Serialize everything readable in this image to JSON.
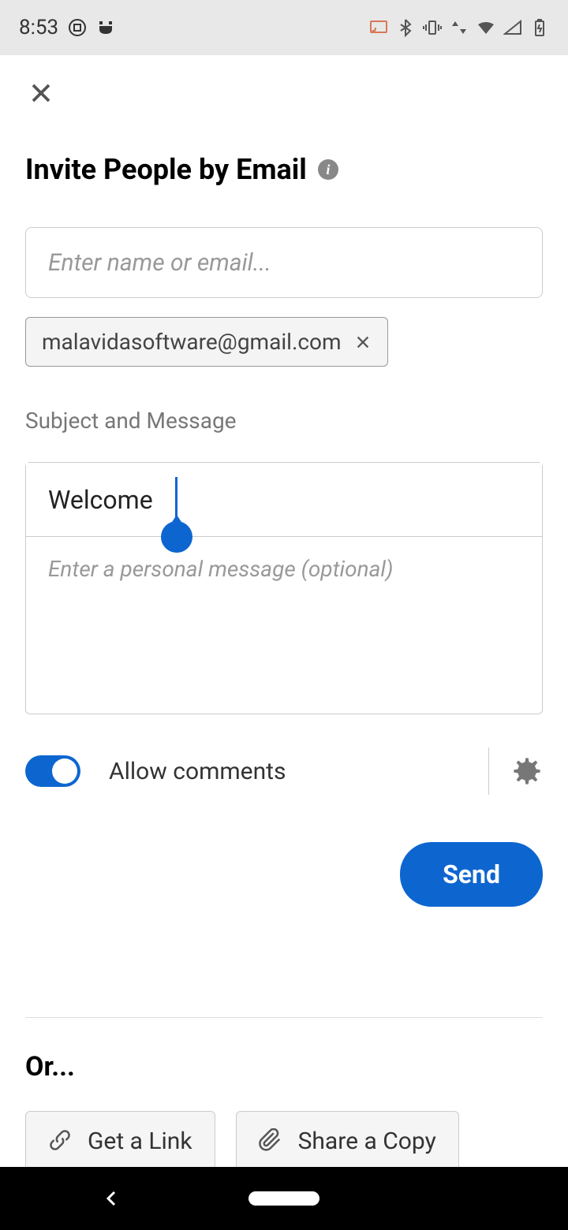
{
  "statusbar": {
    "time": "8:53"
  },
  "header": {
    "title": "Invite People by Email"
  },
  "emailInput": {
    "placeholder": "Enter name or email..."
  },
  "emailChip": {
    "email": "malavidasoftware@gmail.com"
  },
  "sectionLabel": "Subject and Message",
  "subject": {
    "value": "Welcome"
  },
  "message": {
    "placeholder": "Enter a personal message (optional)"
  },
  "toggle": {
    "label": "Allow comments",
    "enabled": true
  },
  "sendButton": {
    "label": "Send"
  },
  "orLabel": "Or...",
  "actions": {
    "getLink": "Get a Link",
    "shareCopy": "Share a Copy"
  }
}
